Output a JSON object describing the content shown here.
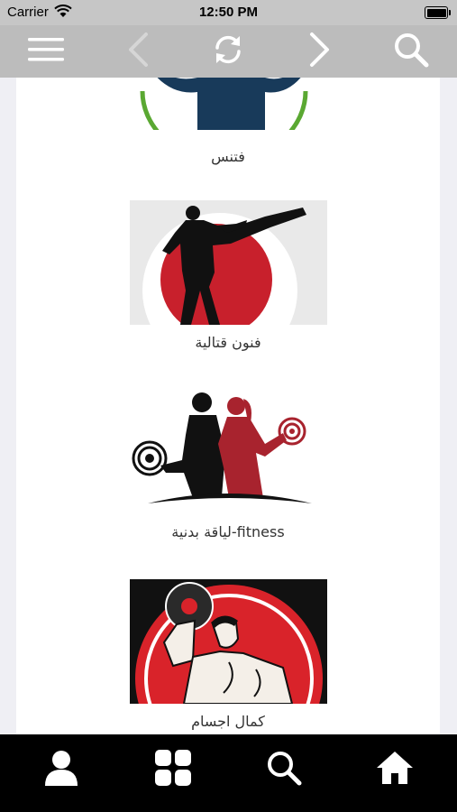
{
  "status_bar": {
    "carrier": "Carrier",
    "time": "12:50 PM"
  },
  "top_nav": {
    "icons": [
      "menu-icon",
      "back-arrow-icon",
      "refresh-icon",
      "forward-arrow-icon",
      "search-icon"
    ]
  },
  "categories": [
    {
      "title": "فتنس",
      "image": "fitness-logo"
    },
    {
      "title": "فنون قتالية",
      "image": "martial-arts-kick-silhouette"
    },
    {
      "title": "لياقة بدنية-fitness",
      "image": "man-woman-dumbbells-silhouette"
    },
    {
      "title": "كمال اجسام",
      "image": "bodybuilder-lifting-dumbbell"
    }
  ],
  "bottom_bar": {
    "icons": [
      "profile-icon",
      "grid-icon",
      "search-icon",
      "home-icon"
    ]
  },
  "colors": {
    "status_bar_bg": "#c6c6c6",
    "nav_bar_bg": "#bcbcbc",
    "content_bg": "#efeff4",
    "tab_bar_bg": "#000000",
    "accent_red": "#c8202c",
    "fitness_navy": "#183a5a",
    "fitness_green": "#5aa832"
  }
}
